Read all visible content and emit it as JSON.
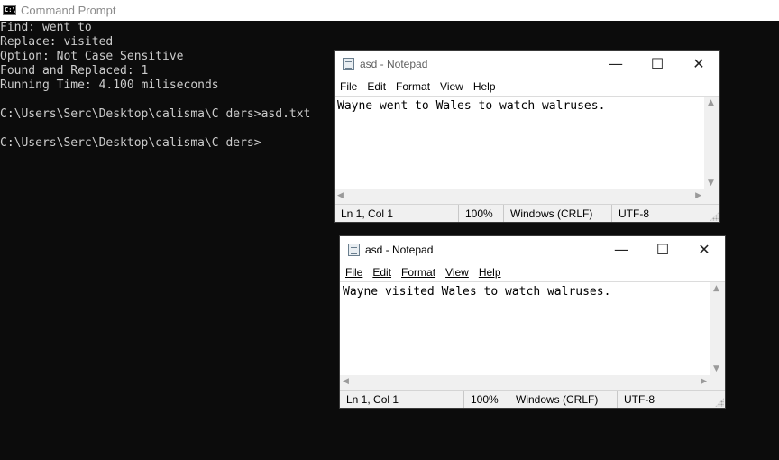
{
  "cmd": {
    "title": "Command Prompt",
    "icon": "cmd-icon",
    "lines": [
      "Find: went to",
      "Replace: visited",
      "Option: Not Case Sensitive",
      "Found and Replaced: 1",
      "Running Time: 4.100 miliseconds",
      "",
      "C:\\Users\\Serc\\Desktop\\calisma\\C ders>asd.txt",
      "",
      "C:\\Users\\Serc\\Desktop\\calisma\\C ders>"
    ]
  },
  "notepad1": {
    "title": "asd - Notepad",
    "menu": [
      "File",
      "Edit",
      "Format",
      "View",
      "Help"
    ],
    "content": "Wayne went to Wales to watch walruses.",
    "status": {
      "position": "Ln 1, Col 1",
      "zoom": "100%",
      "line_ending": "Windows (CRLF)",
      "encoding": "UTF-8"
    }
  },
  "notepad2": {
    "title": "asd - Notepad",
    "menu": [
      "File",
      "Edit",
      "Format",
      "View",
      "Help"
    ],
    "content": "Wayne visited Wales to watch walruses.",
    "status": {
      "position": "Ln 1, Col 1",
      "zoom": "100%",
      "line_ending": "Windows (CRLF)",
      "encoding": "UTF-8"
    }
  },
  "window_controls": {
    "minimize": "—",
    "maximize": "☐",
    "close": "✕"
  }
}
